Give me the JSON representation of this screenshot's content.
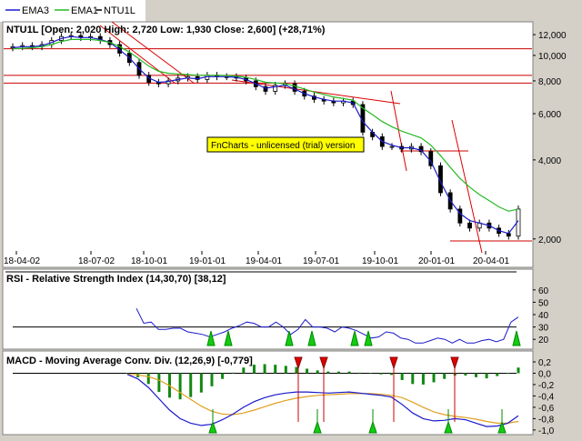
{
  "legend": [
    {
      "name": "EMA3",
      "color": "#1a1acc"
    },
    {
      "name": "EMA1",
      "color": "#22bb22"
    },
    {
      "name": "NTU1L",
      "color": "#000000"
    }
  ],
  "price_title": "NTU1L [Open: 2,020  High: 2,720  Low: 1,930  Close: 2,600] (+28,71%)",
  "watermark": "FnCharts - unlicensed (trial) version",
  "rsi_title": "RSI - Relative Strength Index (14,30,70) [38,12]",
  "macd_title": "MACD - Moving Average Conv. Div. (12,26,9) [-0,779]",
  "chart_data": [
    {
      "type": "candlestick",
      "title": "NTU1L",
      "x_ticks": [
        "18-04-02",
        "18-07-02",
        "18-10-01",
        "19-01-01",
        "19-04-01",
        "19-07-01",
        "19-10-01",
        "20-01-01",
        "20-04-01"
      ],
      "y_ticks": [
        "12,000",
        "10,000",
        "8,000",
        "6,000",
        "4,000",
        "2,000"
      ],
      "y_scale": "log",
      "ylim": [
        1800,
        12800
      ],
      "horizontal_lines": [
        10600,
        8400,
        7850
      ],
      "close": [
        10800,
        10900,
        10800,
        11000,
        11400,
        11800,
        11900,
        11700,
        11800,
        11400,
        11000,
        10200,
        9400,
        8400,
        7900,
        7800,
        8000,
        8200,
        8300,
        8100,
        8400,
        8300,
        8300,
        8200,
        8000,
        7600,
        7300,
        7700,
        7800,
        7300,
        7000,
        6800,
        6700,
        6600,
        6700,
        6500,
        5100,
        4900,
        4500,
        4500,
        4400,
        4500,
        4300,
        3800,
        3000,
        2600,
        2300,
        2200,
        2300,
        2200,
        2100,
        2050,
        2600
      ],
      "series": [
        {
          "name": "EMA3",
          "color": "#1a1acc",
          "values": [
            10700,
            10800,
            10800,
            10900,
            11200,
            11600,
            11800,
            11700,
            11700,
            11500,
            11200,
            10500,
            9800,
            8900,
            8200,
            7900,
            7950,
            8100,
            8200,
            8150,
            8300,
            8300,
            8300,
            8250,
            8100,
            7800,
            7500,
            7600,
            7700,
            7450,
            7150,
            6950,
            6800,
            6700,
            6700,
            6600,
            5600,
            5100,
            4700,
            4550,
            4450,
            4450,
            4350,
            3950,
            3300,
            2800,
            2500,
            2350,
            2300,
            2250,
            2150,
            2100,
            2350
          ]
        },
        {
          "name": "EMA1",
          "color": "#22bb22",
          "values": [
            10600,
            10650,
            10700,
            10800,
            11000,
            11300,
            11500,
            11500,
            11500,
            11400,
            11200,
            10800,
            10300,
            9700,
            9100,
            8700,
            8550,
            8500,
            8450,
            8400,
            8400,
            8400,
            8380,
            8350,
            8250,
            8100,
            7900,
            7850,
            7800,
            7650,
            7450,
            7250,
            7100,
            6950,
            6850,
            6750,
            6300,
            5950,
            5600,
            5350,
            5150,
            5000,
            4850,
            4550,
            4150,
            3750,
            3400,
            3150,
            2950,
            2800,
            2650,
            2550,
            2600
          ]
        }
      ]
    },
    {
      "type": "line",
      "title": "RSI",
      "y_ticks": [
        "60",
        "50",
        "40",
        "30",
        "20"
      ],
      "ylim": [
        15,
        65
      ],
      "level_line": 30,
      "values": [
        45,
        33,
        34,
        28,
        28,
        29,
        29,
        26,
        25,
        24,
        22,
        24,
        26,
        29,
        31,
        34,
        33,
        30,
        30,
        34,
        30,
        24,
        28,
        36,
        30,
        30,
        29,
        26,
        30,
        29,
        27,
        24,
        21,
        22,
        26,
        25,
        21,
        20,
        17,
        17,
        19,
        21,
        20,
        17,
        20,
        17,
        17,
        19,
        20,
        18,
        20,
        34,
        38
      ]
    },
    {
      "type": "bar+line",
      "title": "MACD",
      "y_ticks": [
        "0,2",
        "0,0",
        "-0,2",
        "-0,4",
        "-0,6",
        "-0,8",
        "-1,0"
      ],
      "ylim": [
        -1.05,
        0.28
      ],
      "macd": [
        -0.02,
        -0.1,
        -0.25,
        -0.45,
        -0.65,
        -0.8,
        -0.88,
        -0.92,
        -0.9,
        -0.82,
        -0.72,
        -0.6,
        -0.5,
        -0.43,
        -0.38,
        -0.35,
        -0.33,
        -0.33,
        -0.34,
        -0.35,
        -0.34,
        -0.33,
        -0.35,
        -0.37,
        -0.39,
        -0.42,
        -0.55,
        -0.7,
        -0.8,
        -0.84,
        -0.83,
        -0.8,
        -0.82,
        -0.88,
        -0.94,
        -0.93,
        -0.88,
        -0.75
      ],
      "signal": [
        -0.02,
        -0.03,
        -0.06,
        -0.12,
        -0.22,
        -0.34,
        -0.46,
        -0.58,
        -0.67,
        -0.72,
        -0.73,
        -0.7,
        -0.65,
        -0.59,
        -0.53,
        -0.48,
        -0.44,
        -0.41,
        -0.39,
        -0.38,
        -0.37,
        -0.36,
        -0.36,
        -0.36,
        -0.37,
        -0.39,
        -0.43,
        -0.51,
        -0.6,
        -0.68,
        -0.73,
        -0.76,
        -0.78,
        -0.81,
        -0.85,
        -0.88,
        -0.88,
        -0.85
      ],
      "histogram": [
        0,
        -0.07,
        -0.19,
        -0.33,
        -0.43,
        -0.46,
        -0.42,
        -0.34,
        -0.23,
        -0.1,
        0.01,
        0.1,
        0.15,
        0.16,
        0.15,
        0.13,
        0.11,
        0.08,
        0.05,
        0.03,
        0.03,
        0.03,
        0.01,
        -0.01,
        -0.02,
        -0.03,
        -0.12,
        -0.19,
        -0.2,
        -0.16,
        -0.1,
        -0.04,
        -0.04,
        -0.07,
        -0.09,
        -0.05,
        0,
        0.1
      ]
    }
  ]
}
